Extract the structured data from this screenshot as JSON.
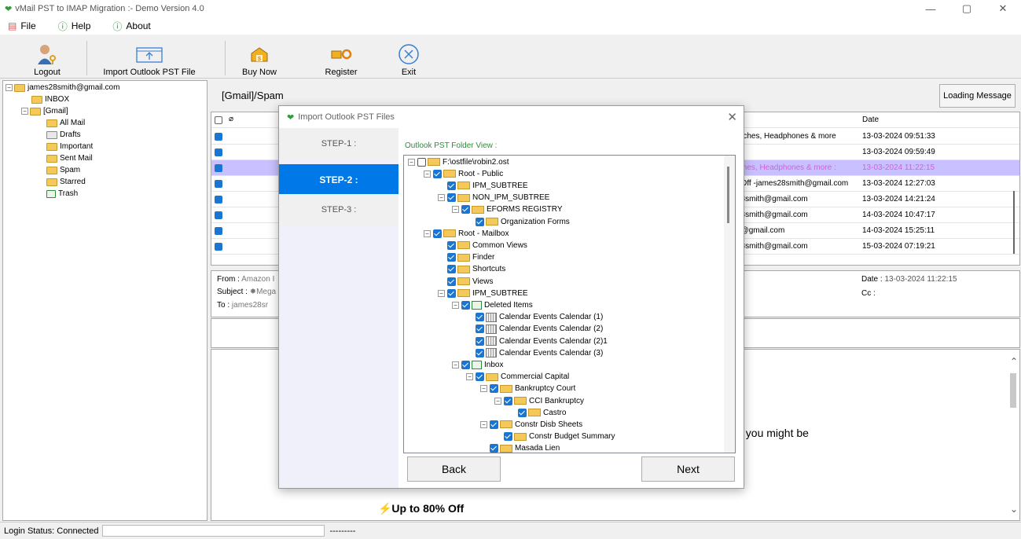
{
  "app": {
    "title": "vMail PST to IMAP Migration :- Demo Version 4.0"
  },
  "window_controls": {
    "minimize": "—",
    "maximize": "▢",
    "close": "✕"
  },
  "menu": [
    {
      "label": "File",
      "icon": "file-icon"
    },
    {
      "label": "Help",
      "icon": "info-icon"
    },
    {
      "label": "About",
      "icon": "info-icon"
    }
  ],
  "toolbar": {
    "logout": "Logout",
    "import": "Import Outlook PST File",
    "buy": "Buy Now",
    "register": "Register",
    "exit": "Exit"
  },
  "account_tree": {
    "root": "james28smith@gmail.com",
    "inbox": "INBOX",
    "gmail": "[Gmail]",
    "items": [
      "All Mail",
      "Drafts",
      "Important",
      "Sent Mail",
      "Spam",
      "Starred",
      "Trash"
    ]
  },
  "main": {
    "folder_title": "[Gmail]/Spam",
    "loading_button": "Loading Message",
    "col_date": "Date",
    "messages": [
      {
        "text": "atches, Headphones & more",
        "date": "13-03-2024 09:51:33"
      },
      {
        "text": "",
        "date": "13-03-2024 09:59:49"
      },
      {
        "text": "tches, Headphones & more :",
        "date": "13-03-2024 11:22:15"
      },
      {
        "text": "; Off -james28smith@gmail.com",
        "date": "13-03-2024 12:27:03"
      },
      {
        "text": "28smith@gmail.com",
        "date": "13-03-2024 14:21:24"
      },
      {
        "text": "28smith@gmail.com",
        "date": "14-03-2024 10:47:17"
      },
      {
        "text": "h@gmail.com",
        "date": "14-03-2024 15:25:11"
      },
      {
        "text": "28smith@gmail.com",
        "date": "15-03-2024 07:19:21"
      }
    ],
    "preview": {
      "from_label": "From :",
      "from_value": "Amazon I",
      "subject_label": "Subject :",
      "subject_value": "✸Mega",
      "to_label": "To :",
      "to_value": "james28sr",
      "date_label": "Date :",
      "date_value": "13-03-2024 11:22:15",
      "cc_label": "Cc :",
      "body_fragment": "t you might be",
      "offer": "⚡Up to 80% Off"
    }
  },
  "status": {
    "label": "Login Status: Connected",
    "dashes": "---------"
  },
  "dialog": {
    "title": "Import Outlook PST Files",
    "steps": [
      "STEP-1 :",
      "STEP-2 :",
      "STEP-3 :"
    ],
    "view_label": "Outlook PST Folder View :",
    "tree": [
      {
        "label": "F:\\ostfile\\robin2.ost",
        "level": 0,
        "checked": false,
        "exp": "−",
        "icon": "folder"
      },
      {
        "label": "Root - Public",
        "level": 1,
        "checked": true,
        "exp": "−",
        "icon": "folder"
      },
      {
        "label": "IPM_SUBTREE",
        "level": 2,
        "checked": true,
        "exp": "",
        "icon": "folder"
      },
      {
        "label": "NON_IPM_SUBTREE",
        "level": 2,
        "checked": true,
        "exp": "−",
        "icon": "folder"
      },
      {
        "label": "EFORMS REGISTRY",
        "level": 3,
        "checked": true,
        "exp": "−",
        "icon": "folder"
      },
      {
        "label": "Organization Forms",
        "level": 4,
        "checked": true,
        "exp": "",
        "icon": "folder"
      },
      {
        "label": "Root - Mailbox",
        "level": 1,
        "checked": true,
        "exp": "−",
        "icon": "folder"
      },
      {
        "label": "Common Views",
        "level": 2,
        "checked": true,
        "exp": "",
        "icon": "folder"
      },
      {
        "label": "Finder",
        "level": 2,
        "checked": true,
        "exp": "",
        "icon": "folder"
      },
      {
        "label": "Shortcuts",
        "level": 2,
        "checked": true,
        "exp": "",
        "icon": "folder"
      },
      {
        "label": "Views",
        "level": 2,
        "checked": true,
        "exp": "",
        "icon": "folder"
      },
      {
        "label": "IPM_SUBTREE",
        "level": 2,
        "checked": true,
        "exp": "−",
        "icon": "folder"
      },
      {
        "label": "Deleted Items",
        "level": 3,
        "checked": true,
        "exp": "−",
        "icon": "trash"
      },
      {
        "label": "Calendar Events Calendar (1)",
        "level": 4,
        "checked": true,
        "exp": "",
        "icon": "calendar"
      },
      {
        "label": "Calendar Events Calendar (2)",
        "level": 4,
        "checked": true,
        "exp": "",
        "icon": "calendar"
      },
      {
        "label": "Calendar Events Calendar (2)1",
        "level": 4,
        "checked": true,
        "exp": "",
        "icon": "calendar"
      },
      {
        "label": "Calendar Events Calendar (3)",
        "level": 4,
        "checked": true,
        "exp": "",
        "icon": "calendar"
      },
      {
        "label": "Inbox",
        "level": 3,
        "checked": true,
        "exp": "−",
        "icon": "inbox"
      },
      {
        "label": "Commercial Capital",
        "level": 4,
        "checked": true,
        "exp": "−",
        "icon": "folder"
      },
      {
        "label": "Bankruptcy Court",
        "level": 5,
        "checked": true,
        "exp": "−",
        "icon": "folder"
      },
      {
        "label": "CCI Bankruptcy",
        "level": 6,
        "checked": true,
        "exp": "−",
        "icon": "folder"
      },
      {
        "label": "Castro",
        "level": 7,
        "checked": true,
        "exp": "",
        "icon": "folder"
      },
      {
        "label": "Constr Disb Sheets",
        "level": 5,
        "checked": true,
        "exp": "−",
        "icon": "folder"
      },
      {
        "label": "Constr Budget Summary",
        "level": 6,
        "checked": true,
        "exp": "",
        "icon": "folder"
      },
      {
        "label": "Masada Lien",
        "level": 5,
        "checked": true,
        "exp": "",
        "icon": "folder"
      }
    ],
    "back": "Back",
    "next": "Next"
  },
  "colors": {
    "accent": "#0078e7",
    "check": "#1976d2",
    "selected_row": "#c9c1ff",
    "view_label": "#2e8b3a"
  }
}
